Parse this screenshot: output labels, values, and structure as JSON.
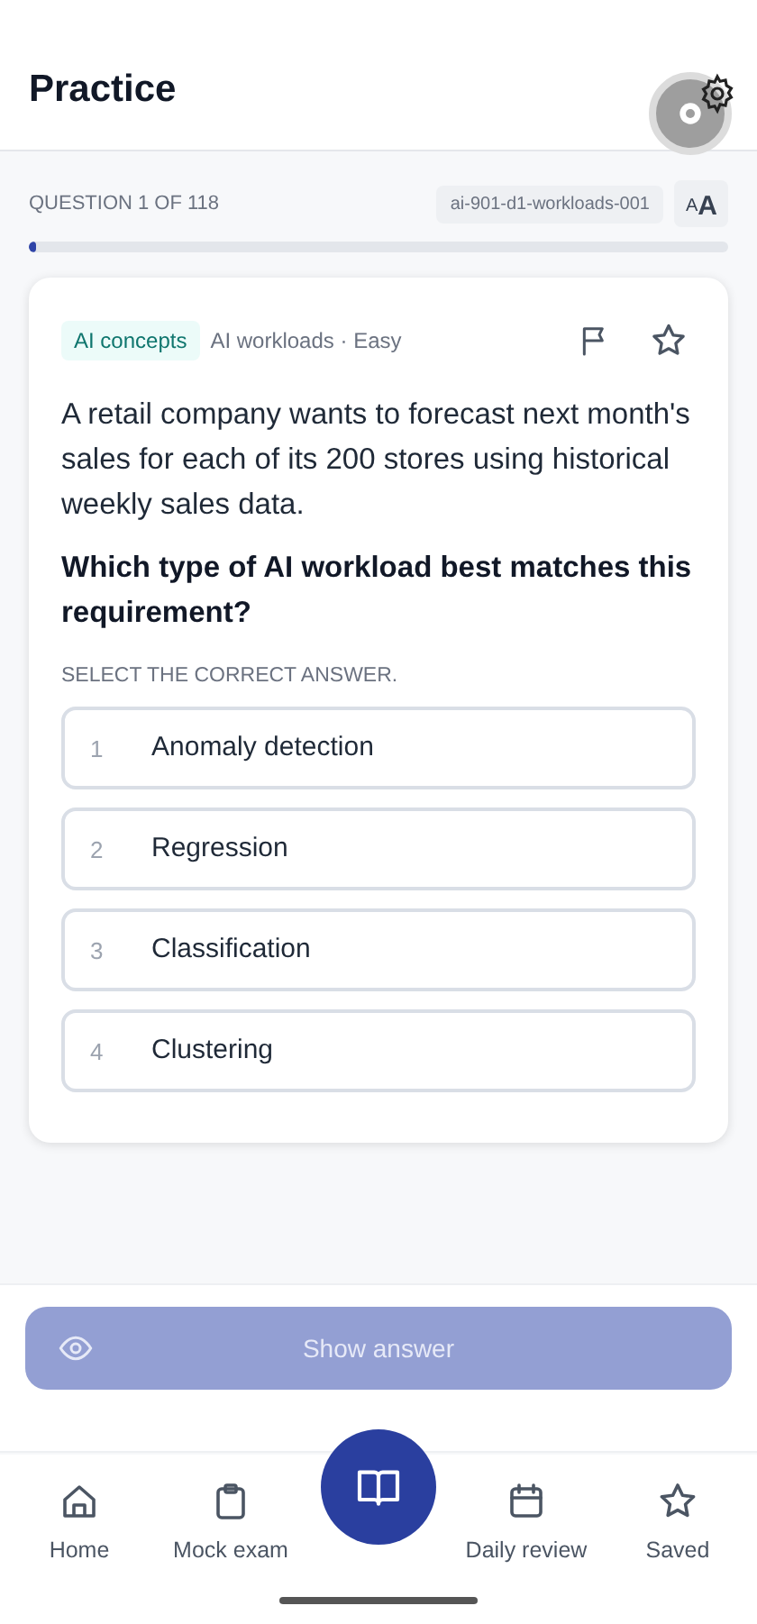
{
  "header": {
    "title": "Practice"
  },
  "progress": {
    "label": "QUESTION 1 OF 118",
    "question_id": "ai-901-d1-workloads-001",
    "font_button": {
      "small": "A",
      "large": "A"
    },
    "level": 0.01
  },
  "question": {
    "tag": "AI concepts",
    "meta": "AI workloads · Easy",
    "flagged": false,
    "saved": false,
    "stem": "A retail company wants to forecast next month's sales for each of its 200 stores using historical weekly sales data.",
    "prompt": "Which type of AI workload best matches this requirement?",
    "instruction": "SELECT THE CORRECT ANSWER.",
    "options": [
      {
        "number": "1",
        "text": "Anomaly detection",
        "selected": false
      },
      {
        "number": "2",
        "text": "Regression",
        "selected": false
      },
      {
        "number": "3",
        "text": "Classification",
        "selected": false
      },
      {
        "number": "4",
        "text": "Clustering",
        "selected": false
      }
    ]
  },
  "show_answer": {
    "label": "Show answer",
    "disabled": true
  },
  "nav": [
    {
      "kind": "home",
      "label": "Home",
      "selected": false
    },
    {
      "kind": "clipboard",
      "label": "Mock exam",
      "selected": false
    },
    {
      "kind": "book",
      "selected": true
    },
    {
      "kind": "calendar",
      "label": "Daily review",
      "selected": false
    },
    {
      "kind": "star",
      "label": "Saved",
      "selected": false
    }
  ]
}
